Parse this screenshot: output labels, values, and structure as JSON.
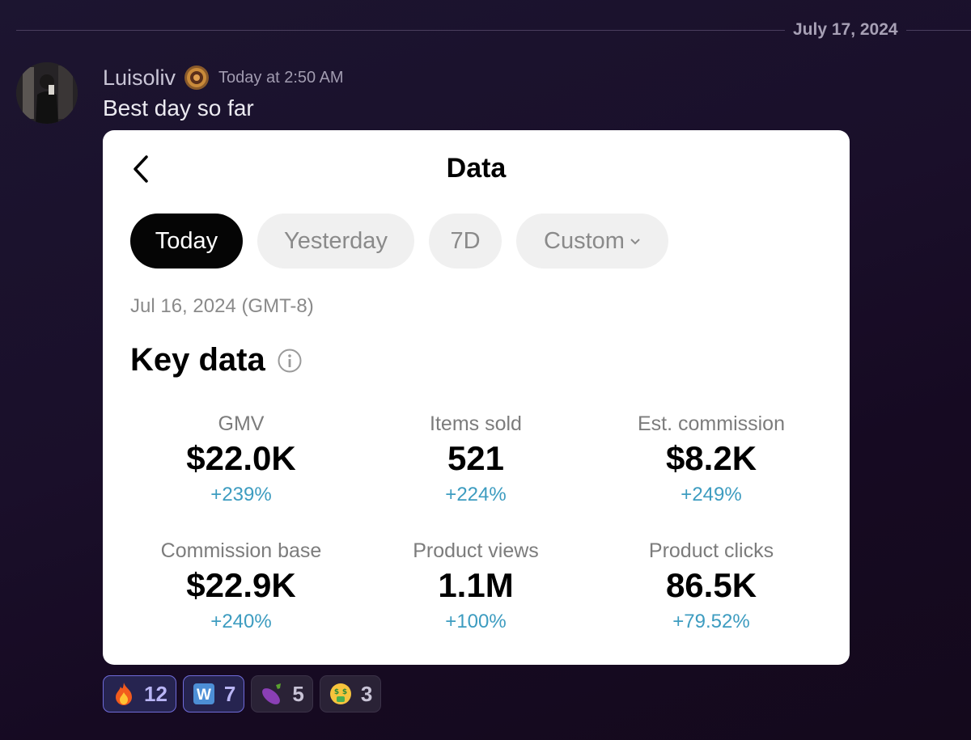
{
  "divider": {
    "date": "July 17, 2024"
  },
  "message": {
    "username": "Luisoliv",
    "timestamp": "Today at 2:50 AM",
    "text": "Best day so far"
  },
  "card": {
    "title": "Data",
    "tabs": [
      {
        "label": "Today",
        "active": true
      },
      {
        "label": "Yesterday",
        "active": false
      },
      {
        "label": "7D",
        "active": false
      },
      {
        "label": "Custom",
        "active": false
      }
    ],
    "date_range": "Jul 16, 2024 (GMT-8)",
    "section_title": "Key data",
    "metrics": [
      {
        "label": "GMV",
        "value": "$22.0K",
        "change": "+239%"
      },
      {
        "label": "Items sold",
        "value": "521",
        "change": "+224%"
      },
      {
        "label": "Est. commission",
        "value": "$8.2K",
        "change": "+249%"
      },
      {
        "label": "Commission base",
        "value": "$22.9K",
        "change": "+240%"
      },
      {
        "label": "Product views",
        "value": "1.1M",
        "change": "+100%"
      },
      {
        "label": "Product clicks",
        "value": "86.5K",
        "change": "+79.52%"
      }
    ]
  },
  "reactions": [
    {
      "icon": "fire-emoji",
      "count": "12",
      "active": true
    },
    {
      "icon": "w-emoji",
      "count": "7",
      "active": true
    },
    {
      "icon": "eggplant-emoji",
      "count": "5",
      "active": false
    },
    {
      "icon": "money-mouth-emoji",
      "count": "3",
      "active": false
    }
  ],
  "colors": {
    "background": "#1a0f2a",
    "card": "#ffffff",
    "change_positive": "#3d9cc0",
    "reaction_active_border": "#6f6bd9",
    "tab_active": "#050505"
  }
}
